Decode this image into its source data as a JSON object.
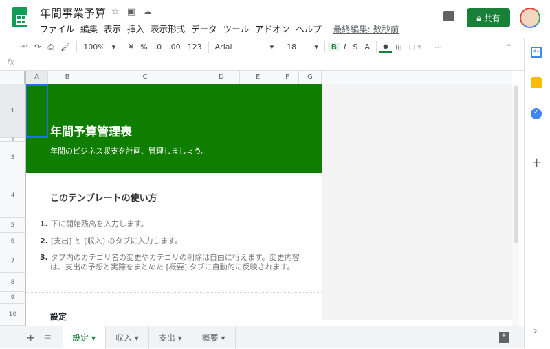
{
  "header": {
    "title": "年間事業予算",
    "menu": [
      "ファイル",
      "編集",
      "表示",
      "挿入",
      "表示形式",
      "データ",
      "ツール",
      "アドオン",
      "ヘルプ"
    ],
    "last_edit": "最終編集: 数秒前",
    "share_label": "共有"
  },
  "toolbar": {
    "zoom": "100%",
    "currency": "¥",
    "percent": "%",
    "dec_less": ".0",
    "dec_more": ".00",
    "format": "123",
    "font": "Arial",
    "size": "18",
    "bold": "B",
    "italic": "I",
    "strike": "S",
    "textcolor": "A",
    "more": "⋯"
  },
  "formula": {
    "fx": "fx",
    "value": ""
  },
  "columns": [
    "A",
    "B",
    "C",
    "D",
    "E",
    "F",
    "G"
  ],
  "rows": [
    "1",
    "2",
    "3",
    "4",
    "5",
    "6",
    "7",
    "8",
    "9",
    "10"
  ],
  "sheet": {
    "title": "年間予算管理表",
    "subtitle": "年間のビジネス収支を計画、管理しましょう。",
    "howto": "このテンプレートの使い方",
    "steps": [
      {
        "n": "1.",
        "t": "下に開始残高を入力します。"
      },
      {
        "n": "2.",
        "t": "[支出] と [収入] のタブに入力します。"
      },
      {
        "n": "3.",
        "t": "タブ内のカテゴリ名の変更やカテゴリの削除は自由に行えます。変更内容は、支出の予想と実際をまとめた [概要] タブに自動的に反映されます。"
      }
    ],
    "settings": "設定"
  },
  "tabs": [
    {
      "label": "設定 ▾",
      "active": true
    },
    {
      "label": "収入 ▾"
    },
    {
      "label": "支出 ▾"
    },
    {
      "label": "概要 ▾"
    }
  ],
  "colors": {
    "banner": "#0f7d00",
    "accent": "#188038"
  }
}
